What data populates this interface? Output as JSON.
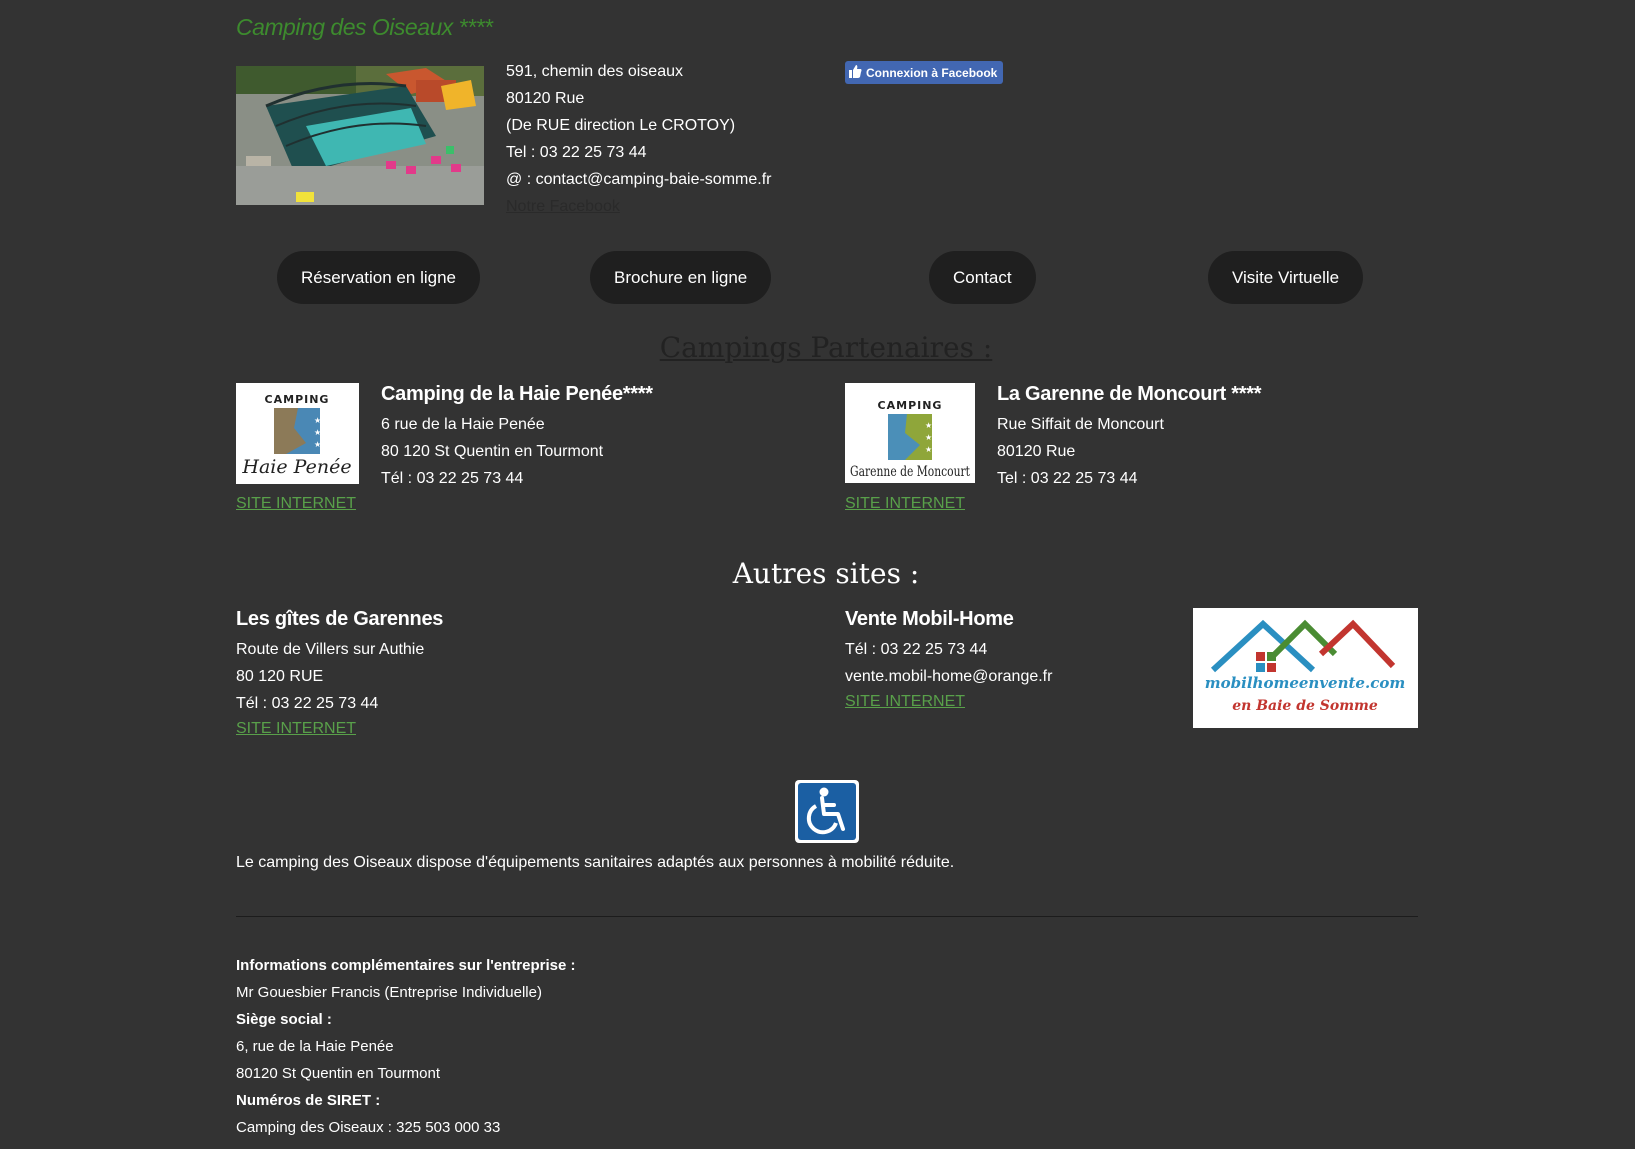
{
  "header": {
    "title": "Camping des Oiseaux ****",
    "address": {
      "street": "591, chemin des oiseaux",
      "city": "80120 Rue",
      "directions": "(De RUE  direction  Le CROTOY)",
      "tel": "Tel :  03 22 25 73 44",
      "email": "@ : contact@camping-baie-somme.fr",
      "facebook_link": "Notre Facebook"
    },
    "facebook_button": "Connexion à Facebook"
  },
  "nav": {
    "reservation": "Réservation en ligne",
    "brochure": "Brochure en ligne",
    "contact": "Contact",
    "visite": "Visite Virtuelle"
  },
  "partners": {
    "heading": "Campings Partenaires :",
    "cards": [
      {
        "name": "Camping de la Haie Penée****",
        "line1": "6 rue de la Haie Penée",
        "line2": "80 120 St Quentin en Tourmont",
        "line3": "Tél : 03 22 25 73 44",
        "link": "SITE INTERNET",
        "logo_top": "CAMPING",
        "logo_bottom": "Haie Penée"
      },
      {
        "name": "La Garenne de Moncourt ****",
        "line1": "Rue Siffait de Moncourt",
        "line2": "80120 Rue",
        "line3": "Tel : 03 22 25 73 44",
        "link": "SITE INTERNET",
        "logo_top": "CAMPING",
        "logo_bottom": "Garenne de Moncourt"
      }
    ]
  },
  "others": {
    "heading": "Autres sites :",
    "gites": {
      "name": "Les gîtes de Garennes",
      "line1": "Route de Villers sur Authie",
      "line2": "80 120 RUE",
      "line3": "Tél : 03 22 25 73 44",
      "link": "SITE INTERNET"
    },
    "mobilhome": {
      "name": "Vente Mobil-Home",
      "line1": "Tél : 03 22 25 73 44",
      "line2": "vente.mobil-home@orange.fr",
      "link": "SITE INTERNET",
      "logo_line1": "mobilhomeenvente.com",
      "logo_line2": "en Baie de Somme"
    }
  },
  "accessibility": {
    "text": "Le camping des Oiseaux dispose d'équipements sanitaires adaptés aux personnes à mobilité réduite."
  },
  "info": {
    "h1": "Informations complémentaires sur l'entreprise :",
    "owner": "Mr Gouesbier Francis (Entreprise Individuelle)",
    "h2": "Siège social :",
    "siege1": "6, rue de la Haie Penée",
    "siege2": "80120 St Quentin en Tourmont",
    "h3": "Numéros de SIRET :",
    "siret1": "Camping des Oiseaux : 325 503 000 33"
  },
  "colors": {
    "background": "#333333",
    "title_green": "#3d8b2e",
    "link_green": "#59a04a",
    "facebook_blue": "#4267b2",
    "nav_button": "#1f1f1f"
  }
}
